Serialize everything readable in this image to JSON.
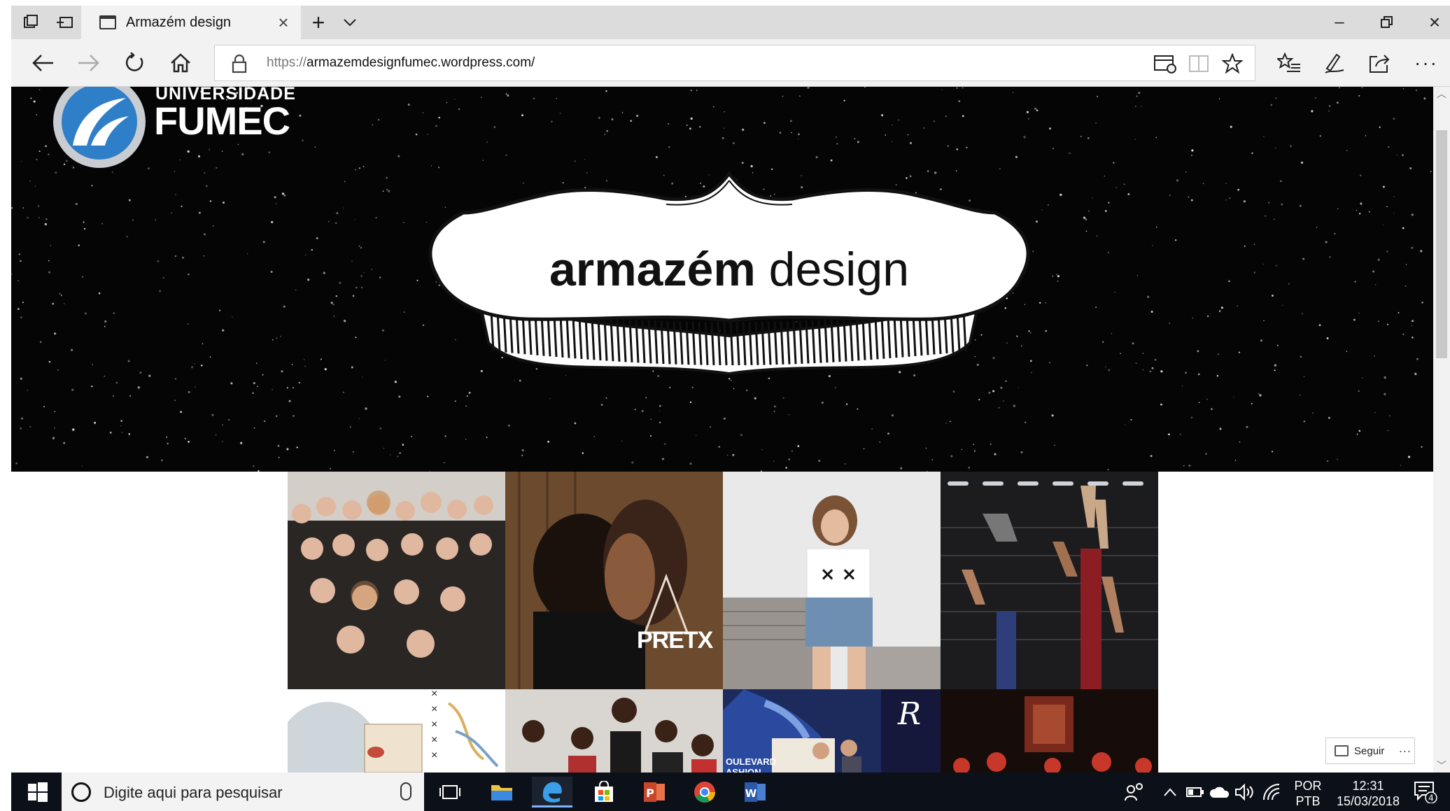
{
  "browser": {
    "tab_title": "Armazém design",
    "url_protocol": "https://",
    "url_host": "armazemdesignfumec.wordpress.com/"
  },
  "banner": {
    "university_line": "UNIVERSIDADE",
    "university_name": "FUMEC",
    "brand_bold": "armazém",
    "brand_light": " design"
  },
  "grid": {
    "pretx_text": "PRETX",
    "boulevard_text": "OULEVARD\nASHION",
    "tile_colors": [
      "#2a2624",
      "#6b4a2e",
      "#9a9490",
      "#1c1c1e",
      "#cfd6db",
      "#d9d6d2",
      "#1c2a5c",
      "#160d0a"
    ]
  },
  "follow": {
    "label": "Seguir",
    "more": "···"
  },
  "taskbar": {
    "search_placeholder": "Digite aqui para pesquisar",
    "lang_top": "POR",
    "lang_bottom": "PTB",
    "time": "12:31",
    "date": "15/03/2018",
    "notification_count": "4"
  },
  "icons": {
    "tab_actions": [
      "tab-aside-icon",
      "tab-preview-icon"
    ],
    "nav": [
      "back-icon",
      "forward-icon",
      "refresh-icon",
      "home-icon"
    ],
    "address": [
      "lock-icon",
      "reading-list-icon",
      "reading-view-icon",
      "favorite-star-icon"
    ],
    "toolbar": [
      "favorites-hub-icon",
      "pen-icon",
      "share-icon",
      "more-icon"
    ],
    "taskbar": [
      "task-view-icon",
      "file-explorer-icon",
      "edge-icon",
      "store-icon",
      "powerpoint-icon",
      "chrome-icon",
      "word-icon"
    ]
  }
}
